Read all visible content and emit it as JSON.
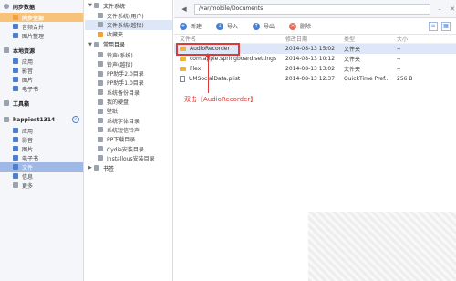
{
  "sidebar": {
    "groups": [
      {
        "label": "同步数据",
        "items": [
          {
            "label": "同步全部",
            "selected": true
          },
          {
            "label": "音频合并"
          },
          {
            "label": "图片整理"
          }
        ]
      },
      {
        "label": "本地资源",
        "items": [
          {
            "label": "应用"
          },
          {
            "label": "影音"
          },
          {
            "label": "图片"
          },
          {
            "label": "电子书"
          }
        ]
      },
      {
        "label": "工具箱",
        "items": []
      },
      {
        "label": "happiest1314",
        "items": [
          {
            "label": "应用"
          },
          {
            "label": "影音"
          },
          {
            "label": "图片"
          },
          {
            "label": "电子书"
          },
          {
            "label": "文件",
            "selected": true
          },
          {
            "label": "信息"
          },
          {
            "label": "更多"
          }
        ]
      }
    ]
  },
  "tree": {
    "group1": "文件系统",
    "items1": [
      "文件系统(用户)",
      "文件系统(越狱)",
      "收藏夹"
    ],
    "group2": "常用目录",
    "items2": [
      "铃声(系统)",
      "铃声(越狱)",
      "PP助手2.0目录",
      "PP助手1.0目录",
      "系统备份目录",
      "我的硬盘",
      "壁纸",
      "系统字体目录",
      "系统短信铃声",
      "PP下载目录",
      "Cydia安装目录",
      "Installous安装目录"
    ],
    "group3": "书签"
  },
  "topbar": {
    "path": "/var/mobile/Documents"
  },
  "toolbar": {
    "new": "新建",
    "import": "导入",
    "export": "导出",
    "delete": "删除"
  },
  "list": {
    "headers": {
      "name": "文件名",
      "date": "修改日期",
      "type": "类型",
      "size": "大小"
    },
    "rows": [
      {
        "name": "AudioRecorder",
        "date": "2014-08-13 15:02",
        "type": "文件夹",
        "size": "--",
        "kind": "folder"
      },
      {
        "name": "com.apple.springboard.settings",
        "date": "2014-08-13 10:12",
        "type": "文件夹",
        "size": "--",
        "kind": "folder"
      },
      {
        "name": "Flex",
        "date": "2014-08-13 13:02",
        "type": "文件夹",
        "size": "--",
        "kind": "folder"
      },
      {
        "name": "UMSocialData.plist",
        "date": "2014-08-13 12:37",
        "type": "QuickTime Pref...",
        "size": "256 B",
        "kind": "file"
      }
    ]
  },
  "annotation": "双击【AudioRecorder】"
}
